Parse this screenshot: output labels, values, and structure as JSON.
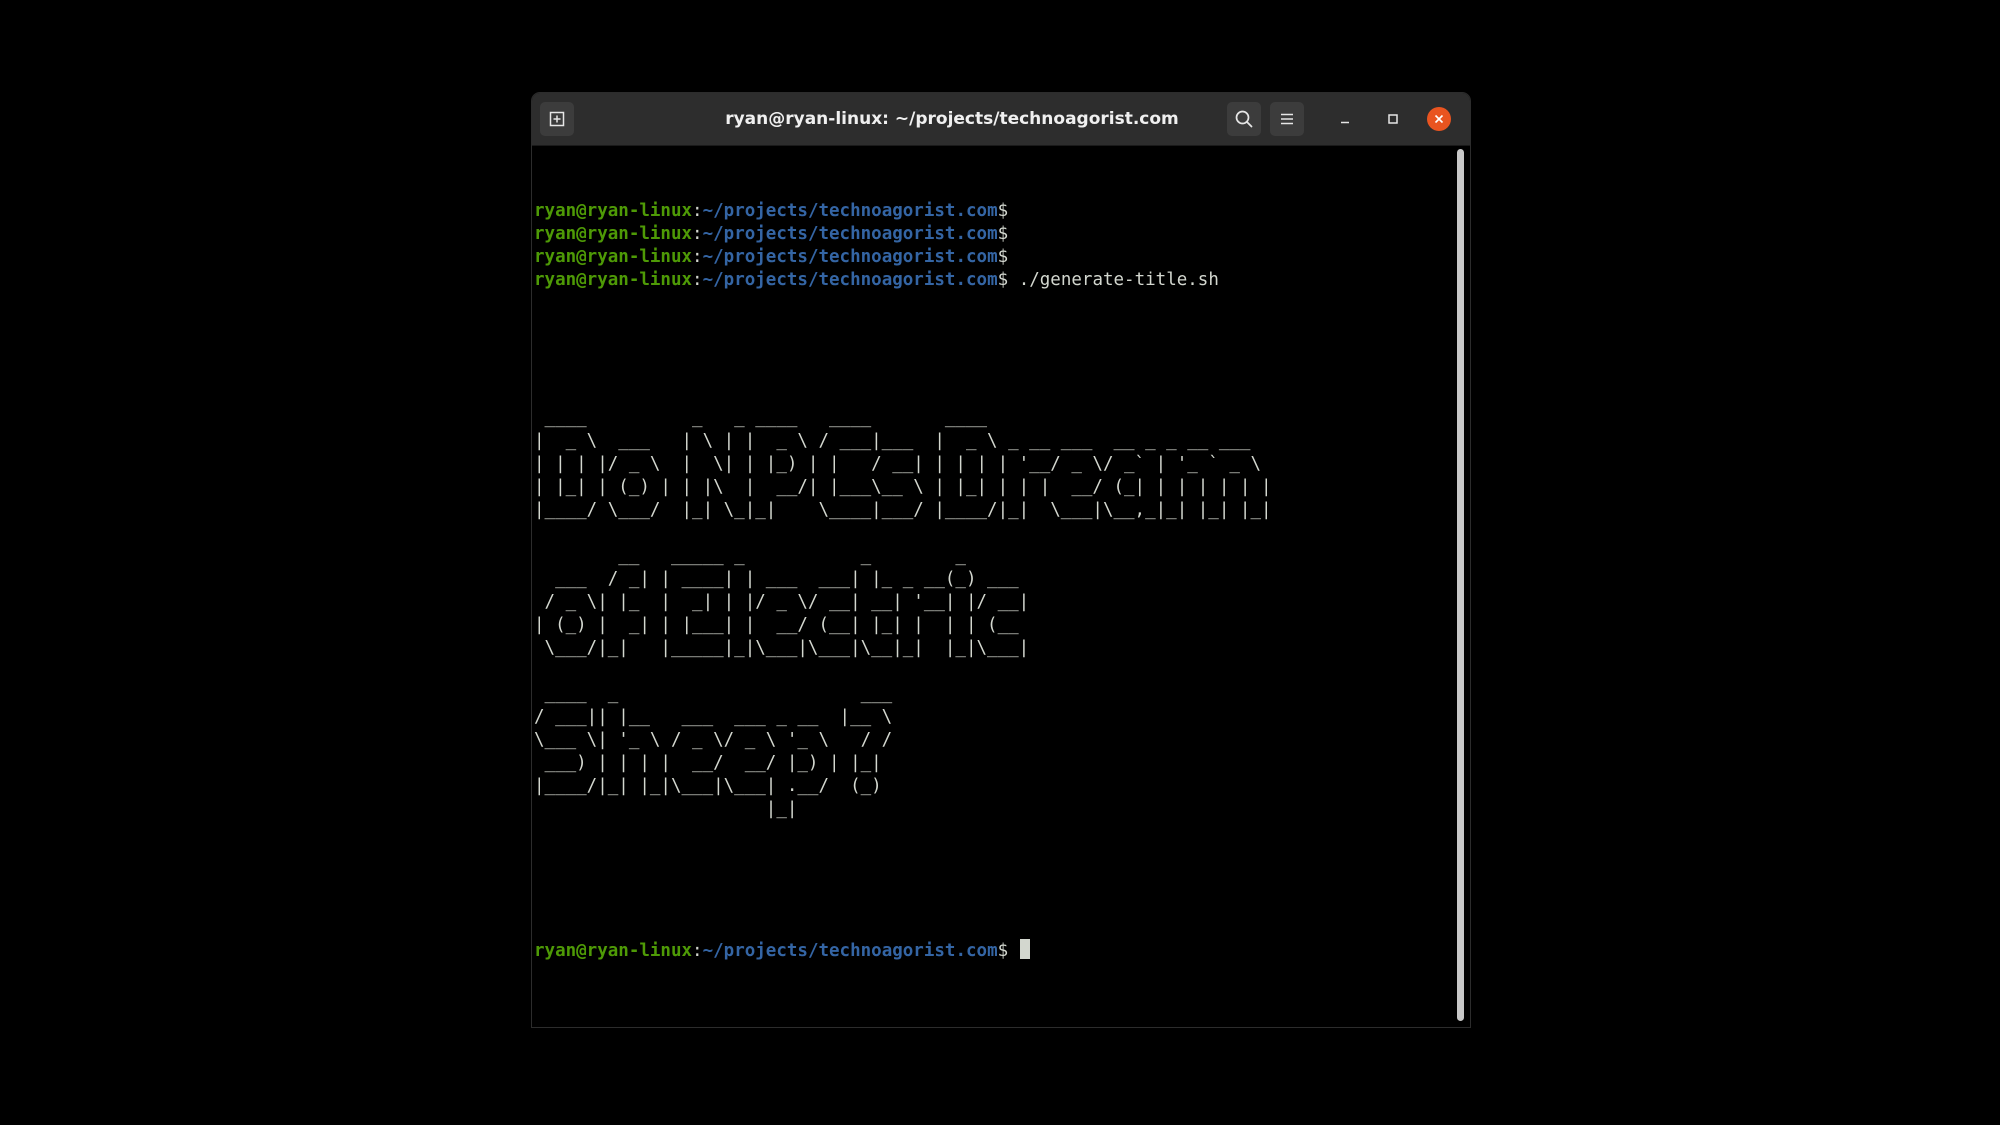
{
  "window": {
    "title": "ryan@ryan-linux: ~/projects/technoagorist.com"
  },
  "prompt": {
    "user_host": "ryan@ryan-linux",
    "colon": ":",
    "path": "~/projects/technoagorist.com",
    "dollar": "$"
  },
  "terminal": {
    "command": " ./generate-title.sh",
    "ascii_art": [
      " ____          _   _ ____   ____       ____\n|  _ \\  ___   | \\ | |  _ \\ / ___|___  |  _ \\ _ __ ___  __ _ _ __ ___\n| | | |/ _ \\  |  \\| | |_) | |   / __| | | | | '__/ _ \\/ _` | '_ ` _ \\\n| |_| | (_) | | |\\  |  __/| |___\\__ \\ | |_| | | |  __/ (_| | | | | | |\n|____/ \\___/  |_| \\_|_|    \\____|___/ |____/|_|  \\___|\\__,_|_| |_| |_|",
      "        __   _____ _           _        _\n  ___  / _| | ____| | ___  ___| |_ _ __(_) ___\n / _ \\| |_  |  _| | |/ _ \\/ __| __| '__| |/ __|\n| (_) |  _| | |___| |  __/ (__| |_| |  | | (__\n \\___/|_|   |_____|_|\\___|\\___|\\__|_|  |_|\\___|",
      " ____  _                       ___\n/ ___|| |__   ___  ___ _ __  |__ \\\n\\___ \\| '_ \\ / _ \\/ _ \\ '_ \\   / /\n ___) | | | |  __/  __/ |_) | |_|\n|____/|_| |_|\\___|\\___| .__/  (_)\n                      |_|"
    ]
  },
  "icons": {
    "new_tab": "new-tab-icon",
    "search": "search-icon",
    "menu": "hamburger-menu-icon",
    "minimize": "minimize-icon",
    "maximize": "maximize-icon",
    "close": "close-icon"
  },
  "colors": {
    "prompt_user": "#4e9a06",
    "prompt_path": "#3465a4",
    "text": "#d3d7cf",
    "background": "#000000",
    "close_button": "#e95420",
    "titlebar": "#2d2d2d"
  }
}
